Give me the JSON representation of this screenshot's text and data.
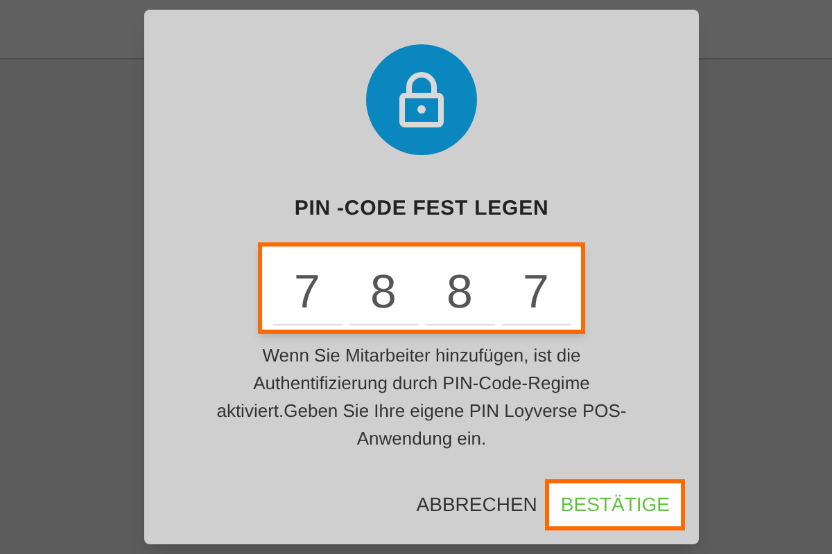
{
  "dialog": {
    "title": "PIN -CODE FEST LEGEN",
    "pin_digits": [
      "7",
      "8",
      "8",
      "7"
    ],
    "description": "Wenn Sie Mitarbeiter hinzufügen, ist die Authentifizierung durch PIN-Code-Regime aktiviert.Geben Sie Ihre eigene PIN Loyverse POS-Anwendung ein.",
    "buttons": [
      {
        "label": "ABBRECHEN",
        "highlighted": false
      },
      {
        "label": "BESTÄTIGE",
        "highlighted": true
      }
    ]
  }
}
